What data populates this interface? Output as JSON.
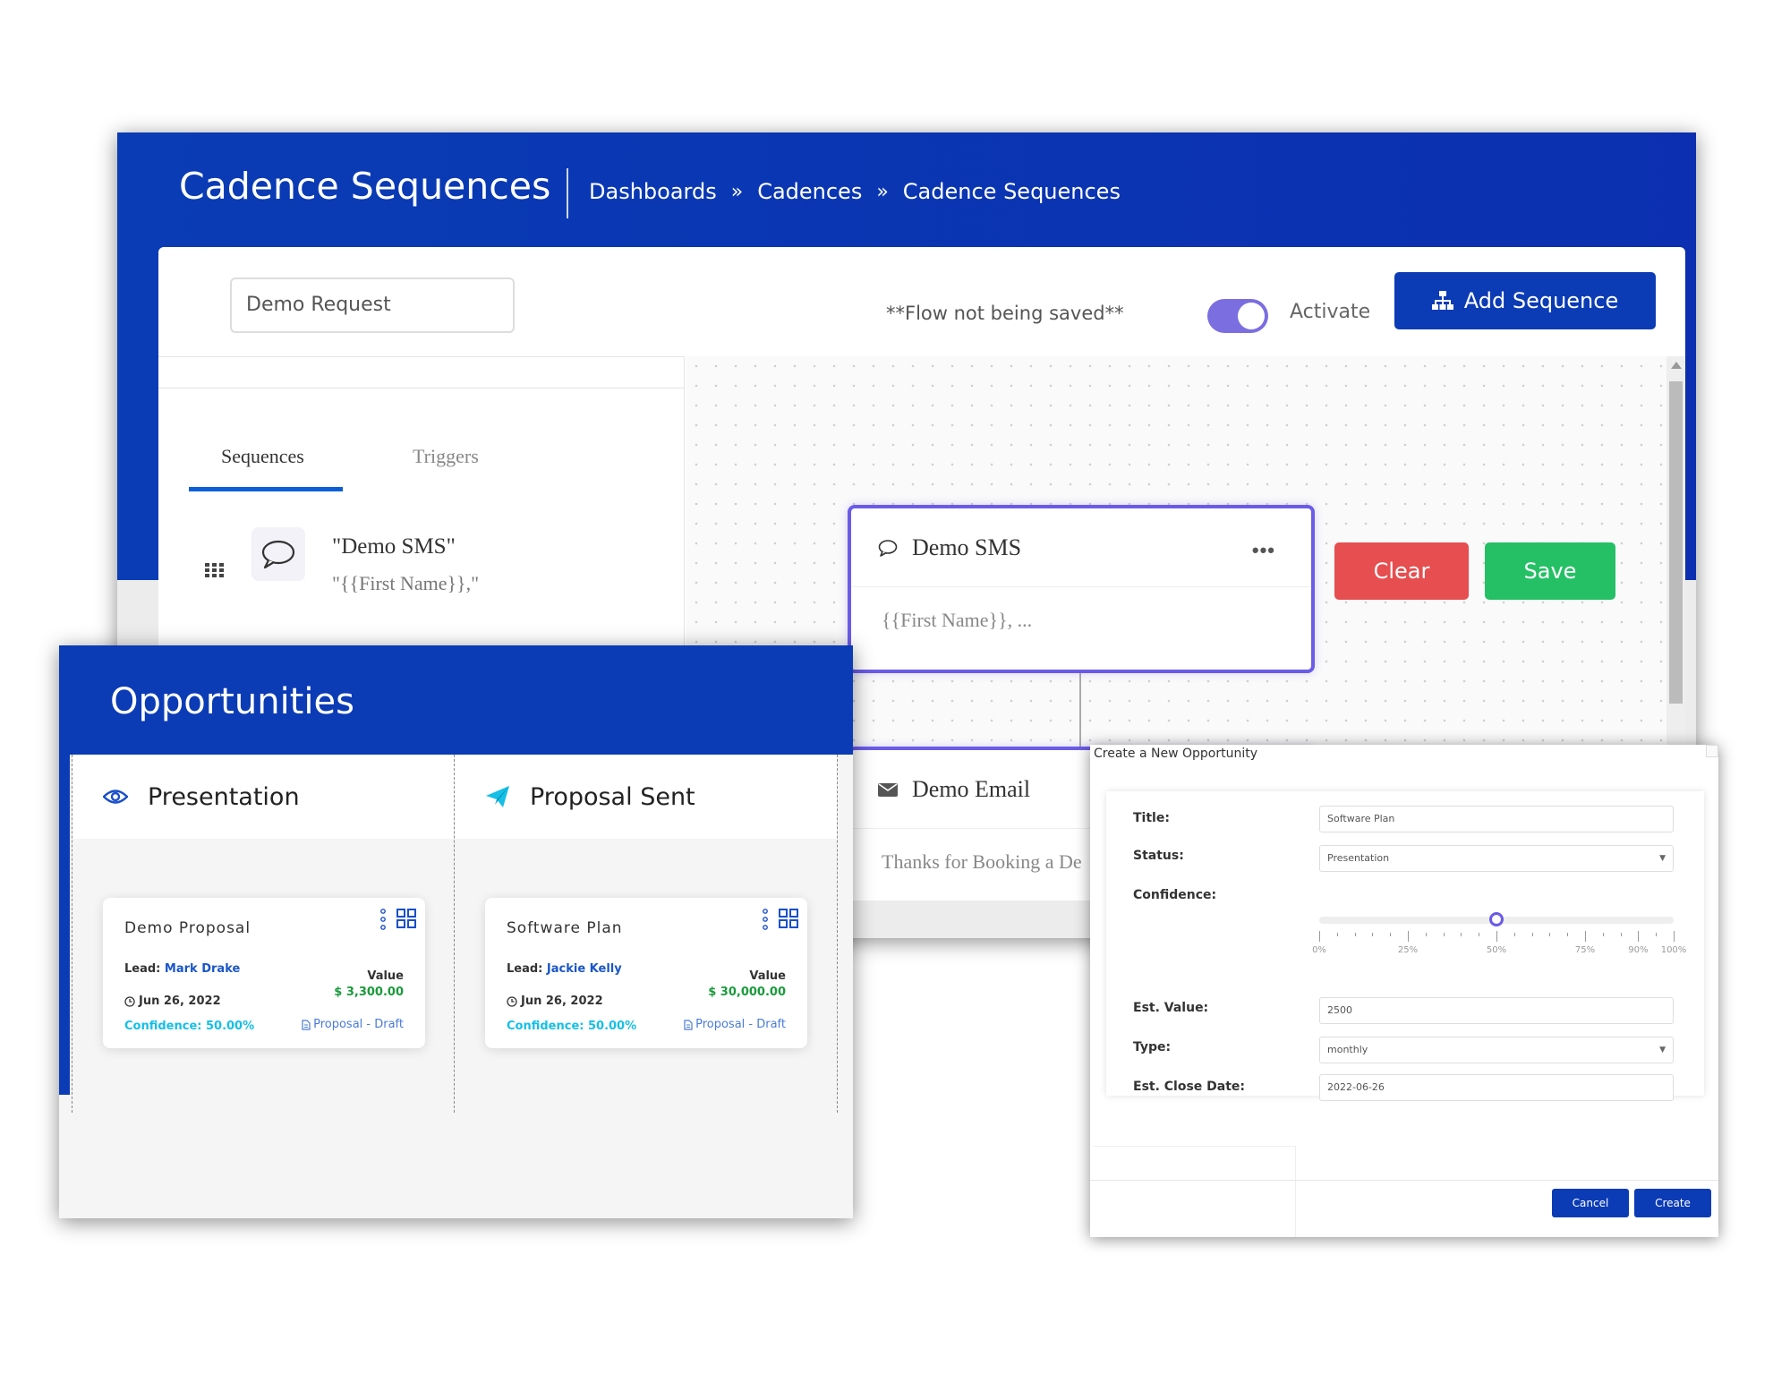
{
  "cadence": {
    "title": "Cadence Sequences",
    "breadcrumb": [
      "Dashboards",
      "Cadences",
      "Cadence Sequences"
    ],
    "breadcrumb_separator": "»",
    "sequence_name_value": "Demo Request",
    "flow_note": "**Flow not being saved**",
    "activate_label": "Activate",
    "activate_on": true,
    "add_sequence_label": "Add Sequence",
    "tabs": {
      "sequences": "Sequences",
      "triggers": "Triggers"
    },
    "side_item": {
      "title": "\"Demo SMS\"",
      "subtitle": "\"{{First Name}},\"",
      "icon": "chat-bubble-icon"
    },
    "nodes": [
      {
        "title": "Demo SMS",
        "body": "{{First Name}}, ...",
        "icon": "chat-bubble-icon",
        "menu": "•••"
      },
      {
        "title": "Demo Email",
        "body": "Thanks for Booking a De",
        "icon": "envelope-icon",
        "menu": "•••"
      }
    ],
    "clear_label": "Clear",
    "save_label": "Save",
    "colors": {
      "header": "#0b3bb5",
      "clear": "#e64e50",
      "save": "#25c065",
      "node_border": "#6a5be8"
    }
  },
  "opportunities": {
    "title": "Opportunities",
    "columns": [
      {
        "title": "Presentation",
        "icon": "eye-icon",
        "card": {
          "title": "Demo Proposal",
          "lead_label": "Lead:",
          "lead_name": "Mark Drake",
          "value_label": "Value",
          "value": "$ 3,300.00",
          "date": "Jun 26, 2022",
          "confidence": "Confidence: 50.00%",
          "proposal_status": "Proposal - Draft"
        }
      },
      {
        "title": "Proposal Sent",
        "icon": "paper-plane-icon",
        "card": {
          "title": "Software Plan",
          "lead_label": "Lead:",
          "lead_name": "Jackie Kelly",
          "value_label": "Value",
          "value": "$ 30,000.00",
          "date": "Jun 26, 2022",
          "confidence": "Confidence: 50.00%",
          "proposal_status": "Proposal - Draft"
        }
      }
    ]
  },
  "modal": {
    "title": "Create a New Opportunity",
    "fields": {
      "title_label": "Title:",
      "title_value": "Software Plan",
      "status_label": "Status:",
      "status_value": "Presentation",
      "confidence_label": "Confidence:",
      "confidence_percent": 50,
      "confidence_ticks": [
        "0%",
        "25%",
        "50%",
        "75%",
        "90%",
        "100%"
      ],
      "est_value_label": "Est. Value:",
      "est_value": "2500",
      "type_label": "Type:",
      "type_value": "monthly",
      "close_date_label": "Est. Close Date:",
      "close_date_value": "2022-06-26"
    },
    "cancel_label": "Cancel",
    "create_label": "Create"
  }
}
